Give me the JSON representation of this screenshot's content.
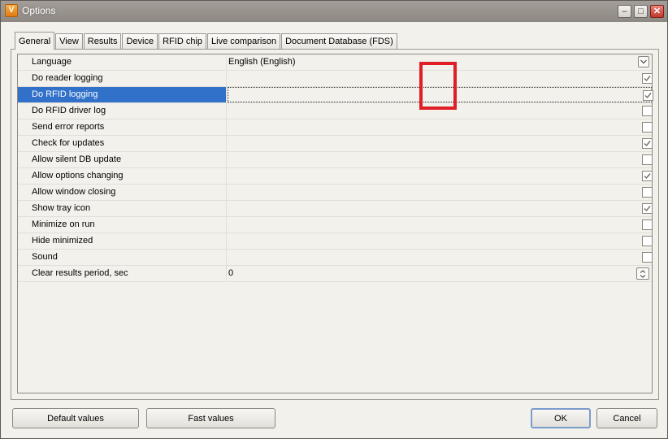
{
  "window": {
    "title": "Options",
    "app_icon_letter": "V",
    "controls": {
      "minimize": "–",
      "maximize": "□",
      "close": "✕"
    }
  },
  "tabs": [
    {
      "label": "General",
      "active": true
    },
    {
      "label": "View"
    },
    {
      "label": "Results"
    },
    {
      "label": "Device"
    },
    {
      "label": "RFID chip"
    },
    {
      "label": "Live comparison"
    },
    {
      "label": "Document Database (FDS)"
    }
  ],
  "settings": [
    {
      "name": "Language",
      "type": "dropdown",
      "value": "English (English)"
    },
    {
      "name": "Do reader logging",
      "type": "checkbox",
      "checked": true
    },
    {
      "name": "Do RFID logging",
      "type": "checkbox",
      "checked": true,
      "selected": true
    },
    {
      "name": "Do RFID driver log",
      "type": "checkbox",
      "checked": false
    },
    {
      "name": "Send error reports",
      "type": "checkbox",
      "checked": false
    },
    {
      "name": "Check for updates",
      "type": "checkbox",
      "checked": true
    },
    {
      "name": "Allow silent DB update",
      "type": "checkbox",
      "checked": false
    },
    {
      "name": "Allow options changing",
      "type": "checkbox",
      "checked": true
    },
    {
      "name": "Allow window closing",
      "type": "checkbox",
      "checked": false
    },
    {
      "name": "Show tray icon",
      "type": "checkbox",
      "checked": true
    },
    {
      "name": "Minimize on run",
      "type": "checkbox",
      "checked": false
    },
    {
      "name": "Hide minimized",
      "type": "checkbox",
      "checked": false
    },
    {
      "name": "Sound",
      "type": "checkbox",
      "checked": false
    },
    {
      "name": "Clear results period, sec",
      "type": "spin",
      "value": "0"
    }
  ],
  "buttons": {
    "default_values": "Default values",
    "fast_values": "Fast values",
    "ok": "OK",
    "cancel": "Cancel"
  },
  "colors": {
    "selection": "#3271c9",
    "annotation": "#e01e26"
  }
}
